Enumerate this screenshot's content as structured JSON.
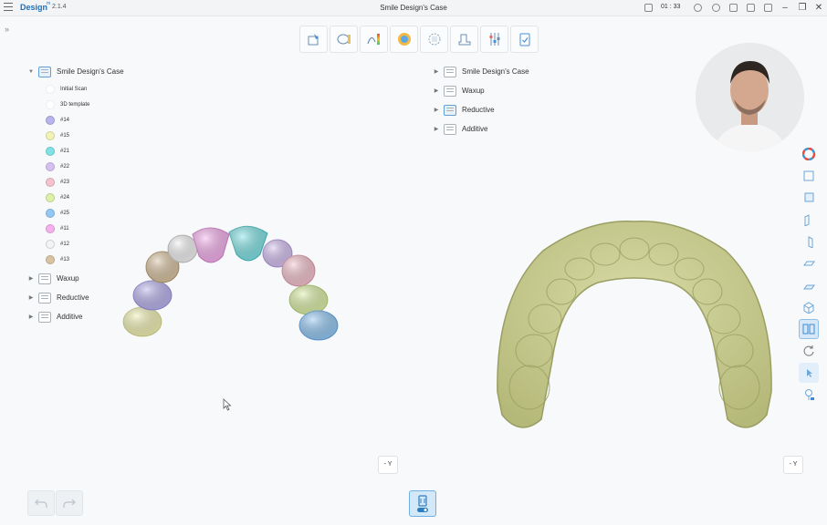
{
  "app": {
    "name": "Design",
    "superscript": "m",
    "version": "2.1.4",
    "window_title": "Smile Design's Case",
    "timer": "01 : 33"
  },
  "left_tree": {
    "root_label": "Smile Design's Case",
    "children": [
      {
        "label": "Initial Scan",
        "color": ""
      },
      {
        "label": "3D template",
        "color": ""
      },
      {
        "label": "#14",
        "color": "#b9b3ee"
      },
      {
        "label": "#15",
        "color": "#f2f2b4"
      },
      {
        "label": "#21",
        "color": "#7fe3e6"
      },
      {
        "label": "#22",
        "color": "#d6c0f2"
      },
      {
        "label": "#23",
        "color": "#f5c3cf"
      },
      {
        "label": "#24",
        "color": "#ddf0a6"
      },
      {
        "label": "#25",
        "color": "#93c8f4"
      },
      {
        "label": "#11",
        "color": "#f6b0ee"
      },
      {
        "label": "#12",
        "color": "#f4f4f4"
      },
      {
        "label": "#13",
        "color": "#d9c3a1"
      }
    ],
    "groups": [
      "Waxup",
      "Reductive",
      "Additive"
    ]
  },
  "right_tree": {
    "items": [
      "Smile Design's Case",
      "Waxup",
      "Reductive",
      "Additive"
    ]
  },
  "views": {
    "left_axis": "- Y",
    "right_axis": "- Y"
  },
  "colors": {
    "accent": "#1a6fc0",
    "model": "#c8cc90"
  },
  "icons": {
    "toolbar": [
      "tooth-select-icon",
      "margin-line-icon",
      "curve-color-icon",
      "tooth-library-icon",
      "rotate-tooth-icon",
      "model-base-icon",
      "adjust-sliders-icon",
      "clipboard-check-icon"
    ],
    "side": [
      "color-wheel-icon",
      "view-front-icon",
      "view-back-icon",
      "view-left-icon",
      "view-right-icon",
      "view-top-icon",
      "view-bottom-icon",
      "view-3d-icon",
      "split-view-icon",
      "reset-rotate-icon",
      "cursor-select-icon",
      "light-icon"
    ]
  }
}
